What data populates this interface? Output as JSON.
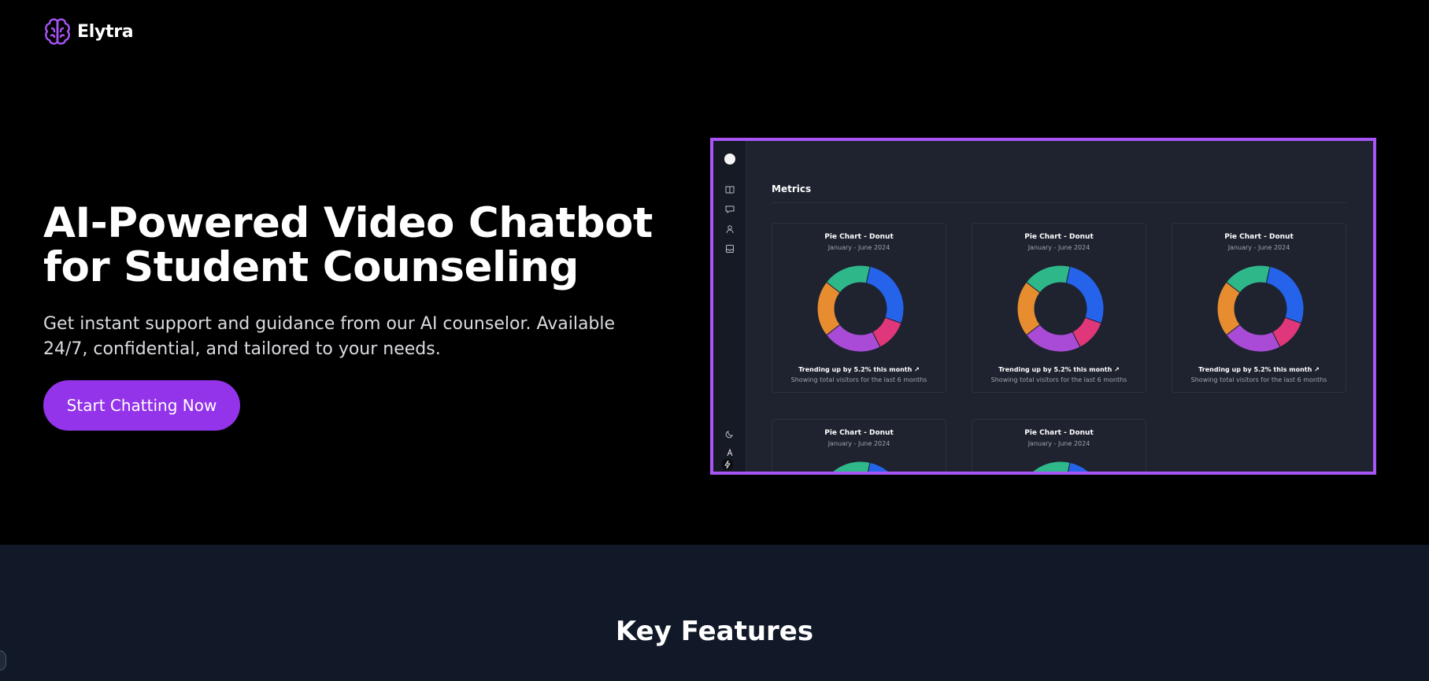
{
  "brand": {
    "name": "Elytra",
    "accent": "#a855f7"
  },
  "hero": {
    "title": "AI-Powered Video Chatbot for Student Counseling",
    "subtitle": "Get instant support and guidance from our AI counselor. Available 24/7, confidential, and tailored to your needs.",
    "cta_label": "Start Chatting Now",
    "cta_color": "#9333ea"
  },
  "preview": {
    "border_color": "#a855f7",
    "sidebar_icons": [
      "book-icon",
      "chat-icon",
      "user-icon",
      "inbox-icon"
    ],
    "bottom_icons": [
      "moon-icon",
      "a-letter-icon",
      "bolt-icon"
    ],
    "section_title": "Metrics",
    "cards": [
      {
        "title": "Pie Chart - Donut",
        "subtitle": "January - June 2024",
        "trend": "Trending up by 5.2% this month",
        "footer": "Showing total visitors for the last 6 months"
      },
      {
        "title": "Pie Chart - Donut",
        "subtitle": "January - June 2024",
        "trend": "Trending up by 5.2% this month",
        "footer": "Showing total visitors for the last 6 months"
      },
      {
        "title": "Pie Chart - Donut",
        "subtitle": "January - June 2024",
        "trend": "Trending up by 5.2% this month",
        "footer": "Showing total visitors for the last 6 months"
      },
      {
        "title": "Pie Chart - Donut",
        "subtitle": "January - June 2024"
      },
      {
        "title": "Pie Chart - Donut",
        "subtitle": "January - June 2024"
      }
    ],
    "slice_colors": [
      "#2563eb",
      "#e0367a",
      "#a94bd6",
      "#e88c30",
      "#2eb88a"
    ],
    "slice_values": [
      27,
      12,
      22,
      21,
      18
    ]
  },
  "features": {
    "title": "Key Features"
  }
}
